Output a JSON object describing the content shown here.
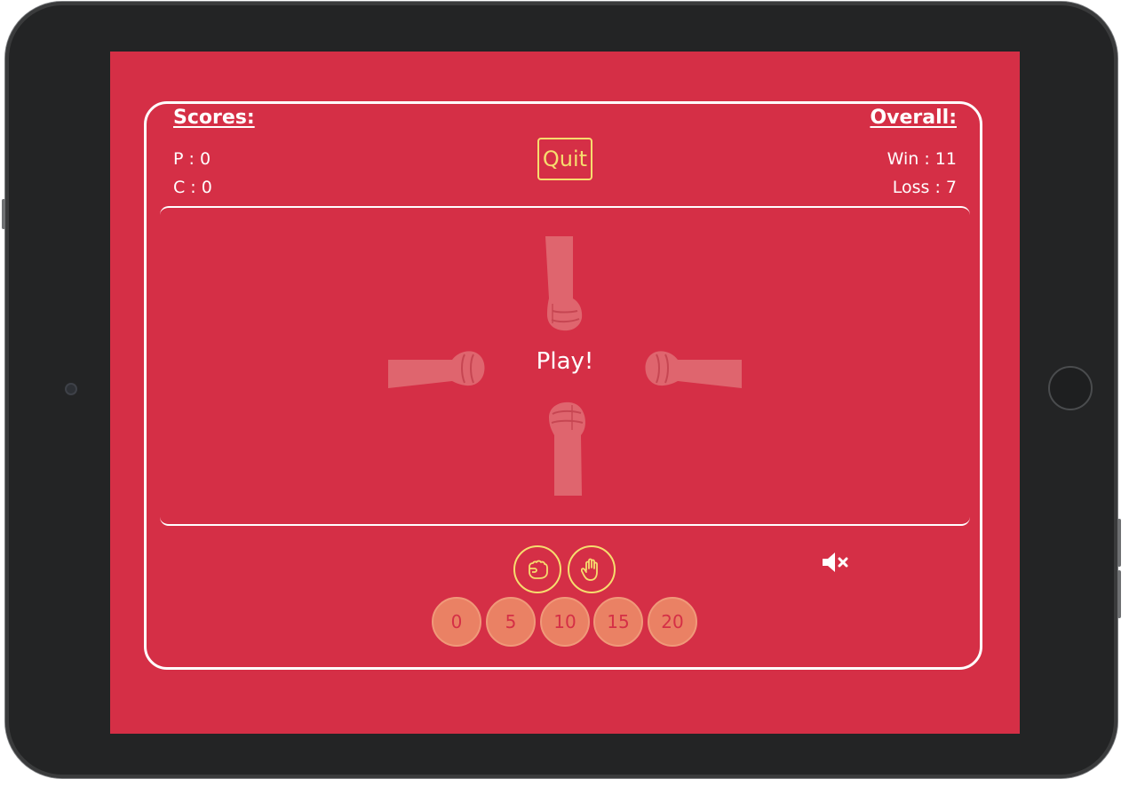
{
  "scores": {
    "heading": "Scores:",
    "player": "P : 0",
    "computer": "C : 0"
  },
  "overall": {
    "heading": "Overall:",
    "wins": "Win : 11",
    "losses": "Loss : 7"
  },
  "controls": {
    "quit_label": "Quit"
  },
  "arena": {
    "status": "Play!"
  },
  "choices": [
    {
      "name": "rock",
      "icon": "fist-icon"
    },
    {
      "name": "paper",
      "icon": "open-hand-icon"
    }
  ],
  "sound": {
    "icon": "speaker-muted-icon",
    "muted": true
  },
  "bets": [
    "0",
    "5",
    "10",
    "15",
    "20"
  ],
  "colors": {
    "background": "#d52f46",
    "accent": "#f6dd6e",
    "bet_chip": "#ea8164",
    "text": "#ffffff",
    "device": "#232425"
  }
}
